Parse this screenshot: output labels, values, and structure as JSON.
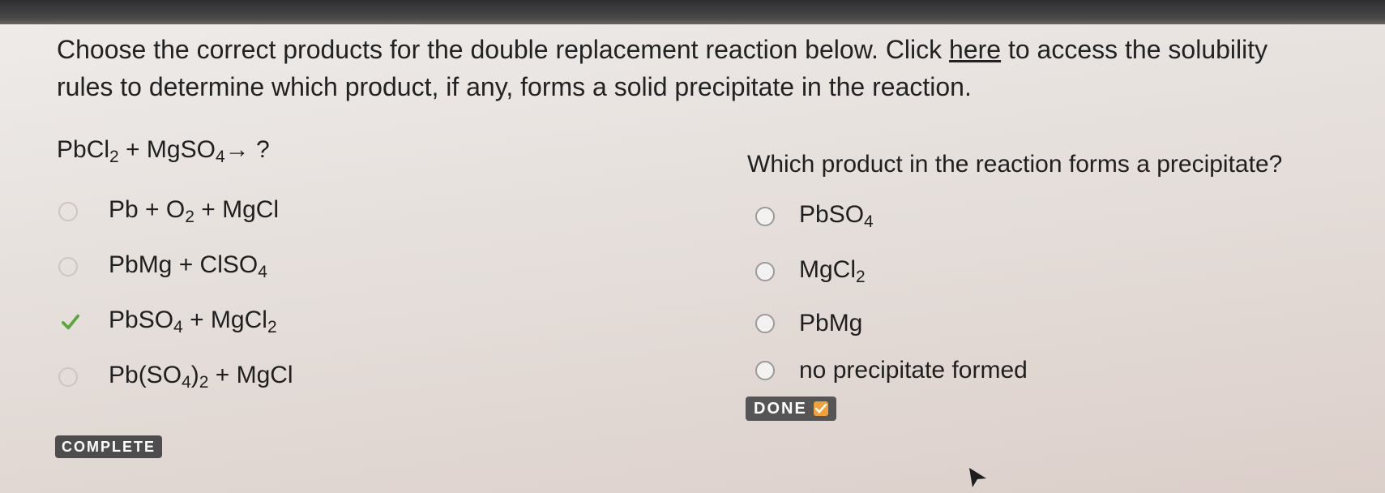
{
  "instructions": {
    "part1": "Choose the correct products for the double replacement reaction below. Click ",
    "link": "here",
    "part2": " to access the solubility rules to determine which product, if any, forms a solid precipitate in the reaction."
  },
  "equation": {
    "r1_a": "PbCl",
    "r1_sub": "2",
    "plus": " + ",
    "r2_a": "MgSO",
    "r2_sub": "4",
    "arrow": "→",
    "q": " ?"
  },
  "left_options": [
    {
      "state": "unselected"
    },
    {
      "state": "unselected"
    },
    {
      "state": "correct",
      "icon": "check-icon"
    },
    {
      "state": "unselected"
    }
  ],
  "opt1": {
    "a": "Pb + O",
    "a_sub": "2",
    "b": " + MgCl"
  },
  "opt2": {
    "a": "PbMg + ClSO",
    "a_sub": "4"
  },
  "opt3": {
    "a": "PbSO",
    "a_sub": "4",
    "b": " + MgCl",
    "b_sub": "2"
  },
  "opt4": {
    "a": "Pb(SO",
    "a_sub": "4",
    "b": ")",
    "b_sub": "2",
    "c": " + MgCl"
  },
  "question": "Which product in the reaction forms a precipitate?",
  "right1": {
    "a": "PbSO",
    "a_sub": "4"
  },
  "right2": {
    "a": "MgCl",
    "a_sub": "2"
  },
  "right3": {
    "a": "PbMg"
  },
  "right4": {
    "a": "no precipitate formed"
  },
  "done_label": "DONE",
  "complete_label": "COMPLETE",
  "colors": {
    "check": "#5aa63a",
    "badge": "#555555",
    "done_tick": "#f0a23a"
  }
}
